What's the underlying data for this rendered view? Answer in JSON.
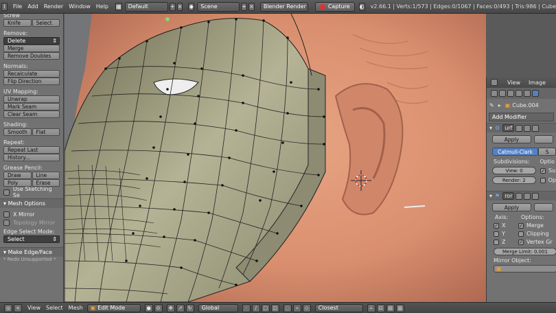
{
  "topbar": {
    "menus": [
      "File",
      "Add",
      "Render",
      "Window",
      "Help"
    ],
    "layout": "Default",
    "scene": "Scene",
    "engine": "Blender Render",
    "capture": "Capture",
    "stats": "v2.66.1 | Verts:1/573 | Edges:0/1067 | Faces:0/493 | Tris:986 | Cube"
  },
  "toolshelf": {
    "top_label": "Screw",
    "knife": "Knife",
    "select": "Select",
    "remove_label": "Remove:",
    "delete": "Delete",
    "merge": "Merge",
    "remove_doubles": "Remove Doubles",
    "normals_label": "Normals:",
    "recalculate": "Recalculate",
    "flip_direction": "Flip Direction",
    "uv_label": "UV Mapping:",
    "unwrap": "Unwrap",
    "mark_seam": "Mark Seam",
    "clear_seam": "Clear Seam",
    "shading_label": "Shading:",
    "smooth": "Smooth",
    "flat": "Flat",
    "repeat_label": "Repeat:",
    "repeat_last": "Repeat Last",
    "history": "History...",
    "grease_label": "Grease Pencil:",
    "draw": "Draw",
    "line": "Line",
    "poly": "Poly",
    "erase": "Erase",
    "use_sketching": "Use Sketching Se",
    "mesh_options": "Mesh Options",
    "x_mirror": "X Mirror",
    "topology_mirror": "Topology Mirror",
    "edge_select_label": "Edge Select Mode:",
    "edge_select_value": "Select",
    "make_edge_face": "Make Edge/Face",
    "redo_note": "* Redo Unsupported *"
  },
  "bottombar": {
    "view": "View",
    "select": "Select",
    "mesh": "Mesh",
    "mode": "Edit Mode",
    "orientation": "Global",
    "snap": "Closest"
  },
  "props": {
    "view": "View",
    "image": "Image",
    "object_name": "Cube.004",
    "add_modifier": "Add Modifier",
    "mod1_name": "urf",
    "apply": "Apply",
    "catmull": "Catmull-Clark",
    "simple": "S",
    "subdivisions_label": "Subdivisions:",
    "options_label": "Optio",
    "view_level": "View: 0",
    "render_level": "Render: 2",
    "sub_opt": "Su",
    "op_opt": "Op",
    "mod2_name": "ror",
    "axis_label": "Axis:",
    "options2_label": "Options:",
    "axis_x": "X",
    "axis_y": "Y",
    "axis_z": "Z",
    "merge": "Merge",
    "clipping": "Clipping",
    "vertex_gr": "Vertex Gr",
    "merge_limit": "Merge Limit: 0.001",
    "mirror_object": "Mirror Object:"
  },
  "colors": {
    "skin": "#dd9676",
    "mesh_face": "#a7a58a",
    "mesh_edge": "#222222",
    "panel_bg": "#727272",
    "selected_blue": "#5680c2"
  }
}
